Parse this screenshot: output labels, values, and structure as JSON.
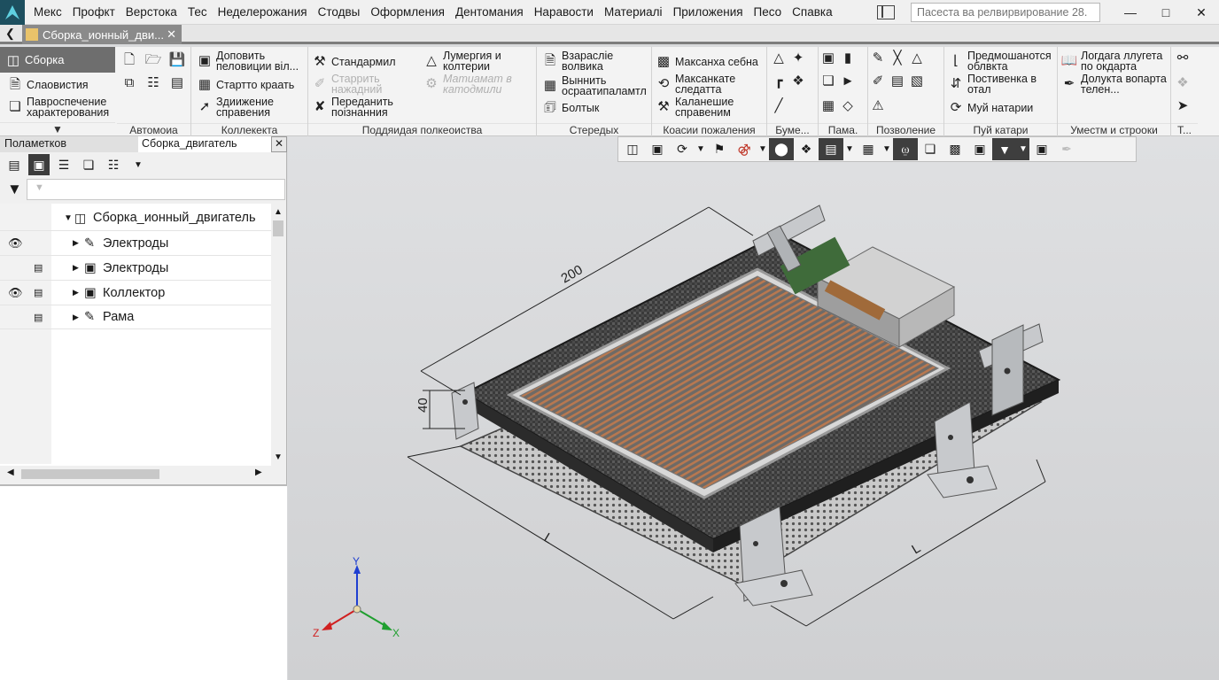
{
  "menubar": {
    "items": [
      "Мекс",
      "Профкт",
      "Верстока",
      "Тес",
      "Неделерожания",
      "Стодвы",
      "Оформления",
      "Дентомания",
      "Наравости",
      "Материалі",
      "Приложения",
      "Песо",
      "Спавка"
    ],
    "search_placeholder": "Пасеста ва релвирвирование 28."
  },
  "tabs": {
    "document": "Сборка_ионный_дви..."
  },
  "ribbon": {
    "tab_active": "Сборка",
    "left_items": [
      "Слаовистия",
      "Павроспечение характерования"
    ],
    "groups": [
      "Автомоиа",
      "Коллекекта",
      "Поддяидая полкеоиства",
      "Стередых",
      "Коасии пожаления",
      "Буме...",
      "Пама.",
      "Позволение",
      "Пуй катари",
      "Уместм и строоки",
      "Т..."
    ],
    "kollekekta": [
      "Доповить пеловиции віл...",
      "Стартто краать",
      "Здиижение справения"
    ],
    "podd": [
      "Стандармил",
      "Старрить нажадний",
      "Переданить поізнанния",
      "Лумергия и колтерии",
      "Матиамат в катодмили"
    ],
    "stered": [
      "Взарасліе волвика",
      "Выннить осраатипаламтл",
      "Болтык"
    ],
    "koasii": [
      "Максанха себна",
      "Максанкате следатта",
      "Каланешие справеним"
    ],
    "puy": [
      "Предмошанотся облвкта",
      "Постивенка в отал",
      "Муй натарии"
    ],
    "umest": [
      "Логдага ллугета по окдарта",
      "Долукта вопарта телен..."
    ]
  },
  "left_panel": {
    "tab1": "Поламетков",
    "tab2": "Сборка_двигатель",
    "tree": {
      "root": "Сборка_ионный_двигатель",
      "items": [
        "Электроды",
        "Электроды",
        "Коллектор",
        "Рама"
      ]
    }
  },
  "viewport": {
    "dimensions": {
      "d200": "200",
      "d40": "40",
      "dL1": "L",
      "dL2": "L"
    },
    "axes": {
      "x": "X",
      "y": "Y",
      "z": "Z"
    }
  }
}
